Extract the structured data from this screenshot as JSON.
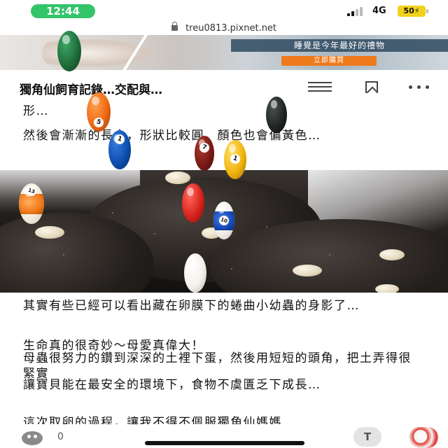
{
  "status_bar": {
    "time": "12:44",
    "network": "4G",
    "battery": "50"
  },
  "browser": {
    "url": "treu0813.pixnet.net"
  },
  "ad": {
    "headline": "睡覺是今年最好的禮物",
    "cta": "立即購買"
  },
  "article": {
    "title": "獨角仙飼育記錄…交配與…",
    "paragraphs": [
      "形…",
      "然後會漸漸的長大，形狀比較圓，顏色也會偏黃色…",
      "其實有些已經可以看出藏在卵膜下的蜷曲小幼蟲的身影了…",
      "生命真的很奇妙～母愛真偉大！",
      "母蟲很努力的鑽到深深的土裡下蛋，然後用短短的頭角，把土弄得很緊實",
      "讓寶貝能在最安全的環境下，食物不虞匱乏下成長…",
      "這次取卵的過程，讓我不得不佩服獨角仙媽媽"
    ]
  },
  "overlay_balls": [
    {
      "number": "",
      "color": "#1f6e3a",
      "kind": "solid"
    },
    {
      "number": "5",
      "color": "#ee6a12",
      "kind": "solid"
    },
    {
      "number": "",
      "color": "#202624",
      "kind": "solid"
    },
    {
      "number": "1",
      "color": "#0c4fb0",
      "kind": "solid"
    },
    {
      "number": "7",
      "color": "#7a1a16",
      "kind": "solid"
    },
    {
      "number": "1",
      "color": "#f2b50d",
      "kind": "solid"
    },
    {
      "number": "13",
      "color": "#f07818",
      "kind": "stripe"
    },
    {
      "number": "",
      "color": "#d9231c",
      "kind": "solid"
    },
    {
      "number": "10",
      "color": "#1448b8",
      "kind": "stripe"
    },
    {
      "number": "",
      "color": "#f3f1ea",
      "kind": "cue"
    }
  ],
  "bottom_bar": {
    "reaction_count": "0",
    "tip_label": "T"
  },
  "colors": {
    "clock_pill": "#33c46a",
    "battery": "#f2d21a",
    "ad_cta": "#ef7a1c"
  },
  "icons": [
    "lock-icon",
    "menu-icon",
    "bookmark-icon",
    "more-icon",
    "reaction-icon",
    "avatar"
  ]
}
